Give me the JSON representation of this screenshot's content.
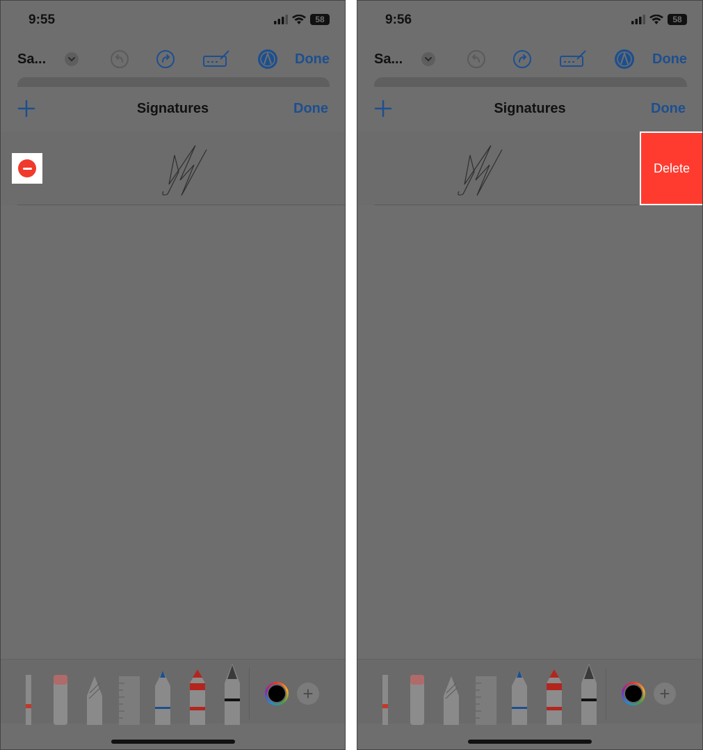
{
  "left_screen": {
    "status": {
      "time": "9:55",
      "battery": "58"
    },
    "toolbar": {
      "title": "Sa...",
      "done_label": "Done"
    },
    "sheet": {
      "title": "Signatures",
      "done_label": "Done"
    }
  },
  "right_screen": {
    "status": {
      "time": "9:56",
      "battery": "58"
    },
    "toolbar": {
      "title": "Sa...",
      "done_label": "Done"
    },
    "sheet": {
      "title": "Signatures",
      "done_label": "Done"
    },
    "delete_label": "Delete"
  },
  "icons": [
    "cellular-signal-icon",
    "wifi-icon",
    "battery-icon",
    "chevron-down-icon",
    "undo-icon",
    "redo-icon",
    "signature-icon",
    "markup-pen-icon",
    "plus-icon",
    "minus-circle-icon",
    "color-picker-icon",
    "add-tool-icon"
  ],
  "colors": {
    "accent": "#1d4f8f",
    "destructive": "#ff3b30",
    "overlay": "#6e6e6e"
  }
}
